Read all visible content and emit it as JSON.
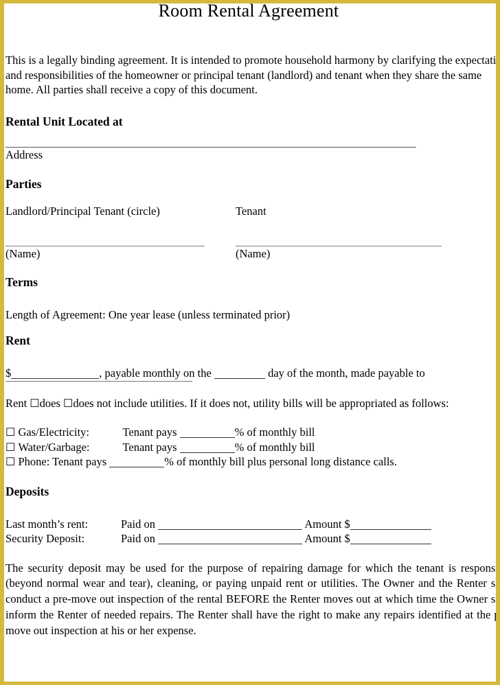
{
  "document": {
    "title": "Room Rental Agreement",
    "border_color": "#d4b93c",
    "intro": "This is a legally binding agreement. It is intended to promote household harmony by clarifying the expectations and responsibilities of the homeowner or principal tenant (landlord) and tenant when they share the same home. All parties shall receive a copy of this document."
  },
  "rental_unit": {
    "heading": "Rental Unit Located at",
    "address_caption": "Address"
  },
  "parties": {
    "heading": "Parties",
    "landlord_label": "Landlord/Principal Tenant (circle)",
    "tenant_label": "Tenant",
    "landlord_name_caption": "(Name)",
    "tenant_name_caption": "(Name)"
  },
  "terms": {
    "heading": "Terms",
    "length": "Length of Agreement: One year lease (unless terminated prior)"
  },
  "rent": {
    "heading": "Rent",
    "currency_symbol": "$",
    "payable_text": ", payable monthly on the",
    "day_text": "day of the month, made payable to",
    "utilities_prefix": "Rent",
    "checkbox_glyph": "☐",
    "does_label": "does",
    "does_not_label": "does not include utilities. If it does not, utility bills will be appropriated as follows:",
    "utilities": [
      {
        "label": "Gas/Electricity:",
        "pays_text": "Tenant pays",
        "suffix": "% of monthly bill"
      },
      {
        "label": "Water/Garbage:",
        "pays_text": "Tenant pays",
        "suffix": "% of monthly bill"
      },
      {
        "label": "Phone: Tenant pays",
        "pays_text": "",
        "suffix": "% of monthly bill plus personal long distance calls."
      }
    ]
  },
  "deposits": {
    "heading": "Deposits",
    "rows": [
      {
        "label": "Last month’s rent:",
        "paid_on_label": "Paid on",
        "amount_label": "Amount $"
      },
      {
        "label": "Security Deposit:",
        "paid_on_label": "Paid on",
        "amount_label": "Amount $"
      }
    ],
    "security_paragraph": "The security deposit may be used for the purpose of repairing damage for which the tenant is responsible (beyond normal wear and tear), cleaning, or paying unpaid rent or utilities. The Owner and the Renter shall conduct a pre-move out inspection of the rental BEFORE the Renter moves out at which time the Owner shall inform the Renter of needed repairs. The Renter shall have the right to make any repairs identified at the pre-move out inspection at his or her expense."
  }
}
